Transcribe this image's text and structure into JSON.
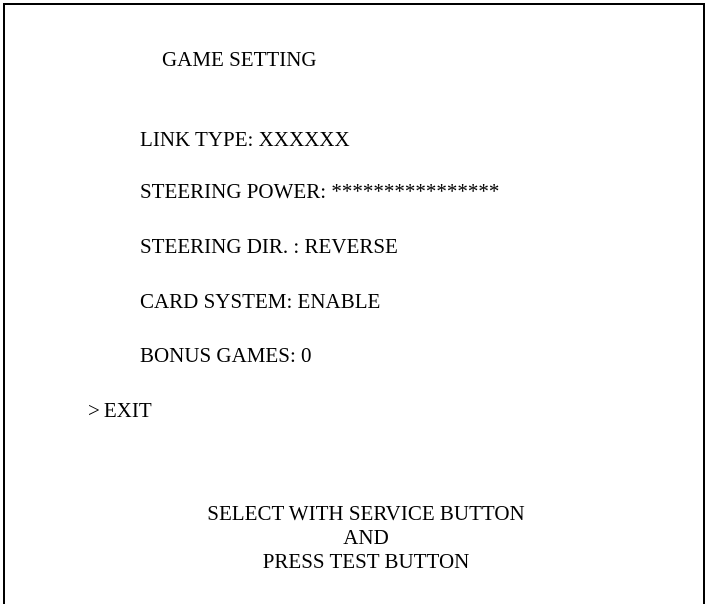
{
  "screen": {
    "title": "GAME SETTING",
    "menu_items": [
      {
        "label": "LINK TYPE",
        "separator": ": ",
        "value": "XXXXXX"
      },
      {
        "label": "STEERING POWER",
        "separator": ": ",
        "value": "****************"
      },
      {
        "label": "STEERING DIR.",
        "separator": " : ",
        "value": "REVERSE"
      },
      {
        "label": "CARD SYSTEM",
        "separator": ": ",
        "value": "ENABLE"
      },
      {
        "label": "BONUS GAMES",
        "separator": ": ",
        "value": "0"
      }
    ],
    "exit": {
      "cursor": ">",
      "label": "EXIT"
    },
    "instructions": [
      "SELECT WITH SERVICE BUTTON",
      "AND",
      "PRESS TEST BUTTON"
    ]
  },
  "colors": {
    "background": "#ffffff",
    "text": "#000000",
    "frame": "#000000"
  }
}
